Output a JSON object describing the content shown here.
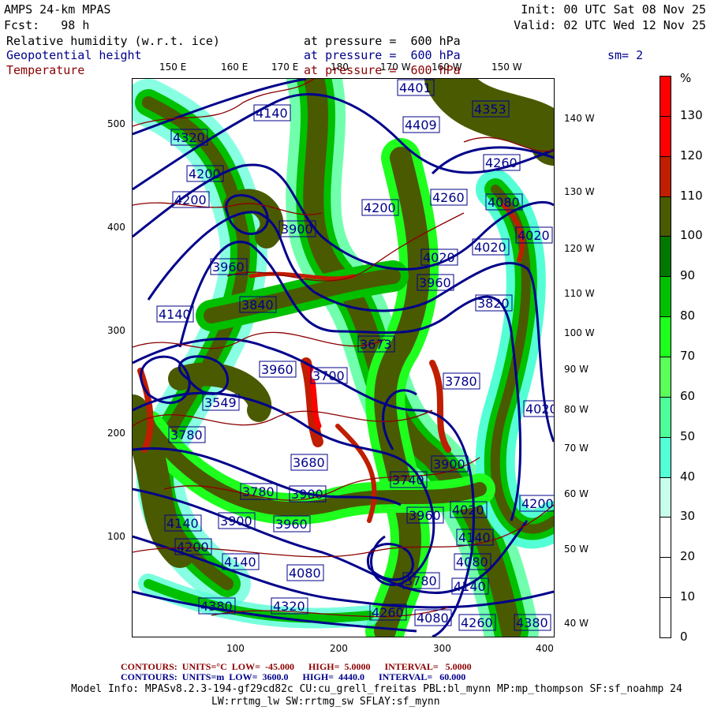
{
  "header": {
    "model": "AMPS 24-km MPAS",
    "fcst": "Fcst:   98 h",
    "init": "Init: 00 UTC Sat 08 Nov 25",
    "valid": "Valid: 02 UTC Wed 12 Nov 25",
    "fields": [
      {
        "name": "Relative humidity (w.r.t. ice)",
        "level": "at pressure =  600 hPa"
      },
      {
        "name": "Geopotential height",
        "level": "at pressure =  600 hPa"
      },
      {
        "name": "Temperature",
        "level": "at pressure =  600 hPa"
      }
    ],
    "smoothing": "sm= 2"
  },
  "axes": {
    "top_lon": [
      "150 E",
      "160 E",
      "170 E",
      "180",
      "170 W",
      "160 W",
      "150 W"
    ],
    "right_lon": [
      "140 W",
      "130 W",
      "120 W",
      "110 W",
      "100 W",
      "90 W",
      "80 W",
      "70 W",
      "60 W",
      "50 W",
      "40 W"
    ],
    "y_ticks": [
      "500",
      "400",
      "300",
      "200",
      "100"
    ],
    "x_ticks": [
      "100",
      "200",
      "300",
      "400"
    ]
  },
  "colorbar": {
    "unit": "%",
    "labels": [
      "130",
      "120",
      "110",
      "100",
      "90",
      "80",
      "70",
      "60",
      "50",
      "40",
      "30",
      "20",
      "10",
      "0"
    ],
    "colors": [
      "#ff0000",
      "#ff0000",
      "#c01e00",
      "#4a5a00",
      "#007800",
      "#00c000",
      "#1eff1e",
      "#5aff5a",
      "#4dff99",
      "#55ffd5",
      "#c8ffec",
      "#ffffff",
      "#ffffff",
      "#ffffff",
      "#ffffff"
    ]
  },
  "height_labels": [
    "4401",
    "4353",
    "4409",
    "4320",
    "4140",
    "4260",
    "4200",
    "4200",
    "4200",
    "4260",
    "4080",
    "4020",
    "4020",
    "4020",
    "3900",
    "3960",
    "3960",
    "3840",
    "4140",
    "3820",
    "3673",
    "3780",
    "3960",
    "3700",
    "3549",
    "4020",
    "3780",
    "3680",
    "3900",
    "3740",
    "3780",
    "3900",
    "4140",
    "3900",
    "3960",
    "3960",
    "4020",
    "4200",
    "4140",
    "4200",
    "4140",
    "4080",
    "4080",
    "3780",
    "4140",
    "4380",
    "4320",
    "4260",
    "4080",
    "4260",
    "4380"
  ],
  "footer": {
    "temp_contours": "CONTOURS:  UNITS=°C  LOW=  -45.000      HIGH=  5.0000      INTERVAL=   5.0000",
    "hgt_contours": "CONTOURS:  UNITS=m  LOW=  3600.0      HIGH=  4440.0      INTERVAL=   60.000",
    "model_info": "Model Info: MPASv8.2.3-194-gf29cd82c CU:cu_grell_freitas PBL:bl_mynn MP:mp_thompson SF:sf_noahmp 24",
    "model_info2": "LW:rrtmg_lw SW:rrtmg_sw SFLAY:sf_mynn"
  }
}
